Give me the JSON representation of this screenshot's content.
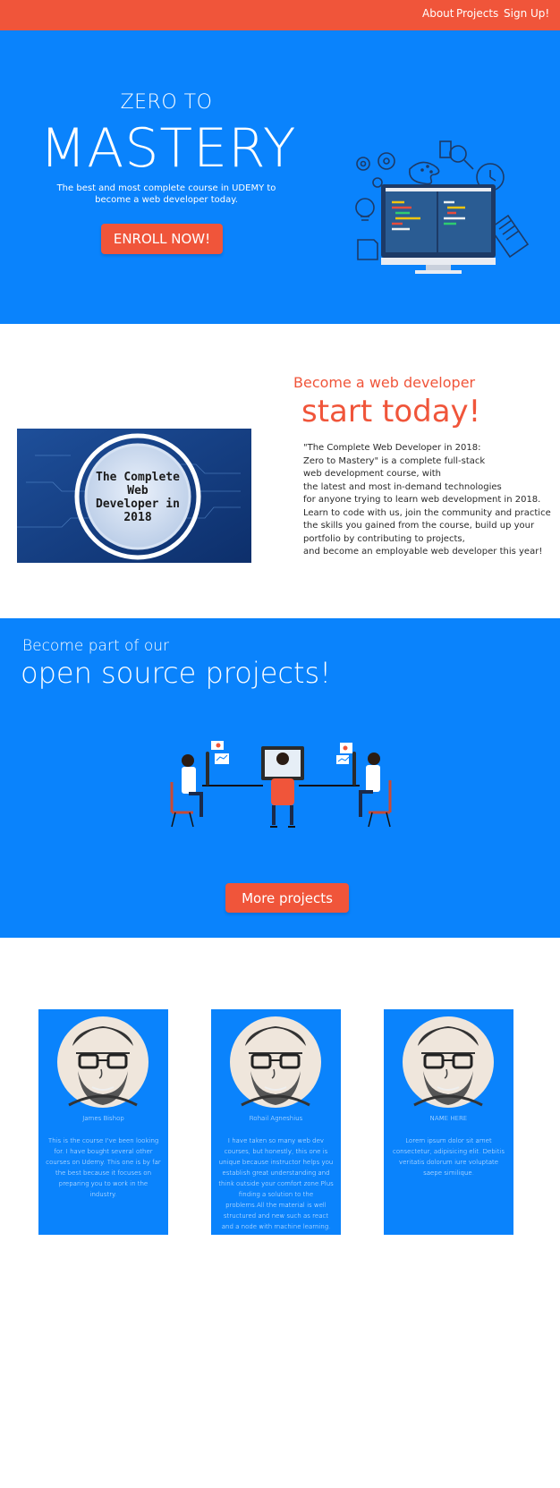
{
  "nav": {
    "about": "About",
    "projects": "Projects",
    "signup": "Sign Up!"
  },
  "hero": {
    "kicker": "ZERO TO",
    "title": "MASTERY",
    "subtitle": "The best and most complete course in UDEMY to become a web developer today.",
    "cta": "ENROLL NOW!"
  },
  "about": {
    "kicker": "Become a web developer",
    "title": "start today!",
    "thumb_title": [
      "The Complete",
      "Web",
      "Developer in",
      "2018"
    ],
    "paragraph": [
      "\"The Complete Web Developer in 2018:",
      "Zero to Mastery\" is a complete full-stack",
      "web development course, with",
      "the latest and most in-demand technologies",
      "for anyone trying to learn web development in 2018.",
      "Learn to code with us, join the community and practice",
      "the skills you gained from the course, build up your",
      "portfolio by contributing to projects,",
      "and become an employable web developer this year!"
    ]
  },
  "projects": {
    "kicker": "Become part of our",
    "title": "open source projects!",
    "cta": "More projects"
  },
  "testimonials": [
    {
      "name": "James Bishop",
      "text": "This is the course I've been looking for. I have bought several other courses on Udemy. This one is by far the best because it focuses on preparing you to work in the industry."
    },
    {
      "name": "Rohail Agneshius",
      "text": "I have taken so many web dev courses, but honestly, this one is unique because instructor helps you establish great understanding and think outside your comfort zone.Plus finding a solution to the problems.All the material is well structured and new such as react and a node with machine learning."
    },
    {
      "name": "NAME HERE",
      "text": "Lorem ipsum dolor sit amet consectetur, adipisicing elit. Debitis veritatis dolorum iure voluptate saepe similique."
    }
  ],
  "colors": {
    "primary_blue": "#0a83fc",
    "accent_orange": "#f0553a",
    "text_dark": "#2a2a2a"
  }
}
